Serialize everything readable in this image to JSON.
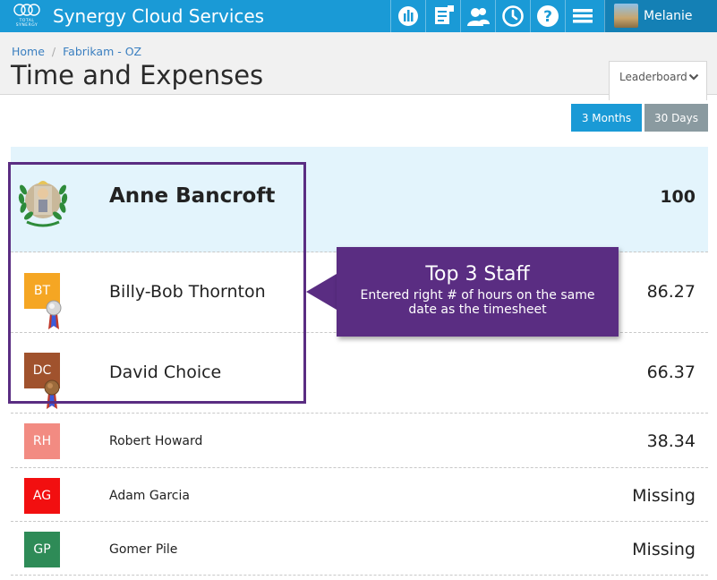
{
  "topbar": {
    "logo_tag_line1": "TOTAL",
    "logo_tag_line2": "SYNERGY",
    "app_title": "Synergy Cloud Services",
    "icons": [
      "dashboard-icon",
      "documents-icon",
      "people-icon",
      "clock-icon",
      "help-icon",
      "menu-icon"
    ],
    "user_name": "Melanie",
    "bar_color": "#1a9ad6"
  },
  "breadcrumb": {
    "items": [
      "Home",
      "Fabrikam - OZ"
    ]
  },
  "page": {
    "title": "Time and Expenses"
  },
  "dropdown": {
    "label": "Leaderboard",
    "icon": "chevron-down-icon"
  },
  "range": {
    "options": [
      "3 Months",
      "30 Days"
    ],
    "selected": "3 Months"
  },
  "leaderboard": {
    "rows": [
      {
        "initials": "",
        "name": "Anne Bancroft",
        "score": "100",
        "rank_icon": "laurel-wreath-icon"
      },
      {
        "initials": "BT",
        "name": "Billy-Bob Thornton",
        "score": "86.27",
        "badge_color": "#f5a623",
        "rank_icon": "silver-medal-icon"
      },
      {
        "initials": "DC",
        "name": "David Choice",
        "score": "66.37",
        "badge_color": "#a0522d",
        "rank_icon": "bronze-medal-icon"
      },
      {
        "initials": "RH",
        "name": "Robert Howard",
        "score": "38.34",
        "badge_color": "#f28b82"
      },
      {
        "initials": "AG",
        "name": "Adam Garcia",
        "score": "Missing",
        "badge_color": "#f20f10"
      },
      {
        "initials": "GP",
        "name": "Gomer Pile",
        "score": "Missing",
        "badge_color": "#2e8b57"
      }
    ]
  },
  "callout": {
    "title": "Top 3 Staff",
    "subtitle": "Entered right # of hours on the same date as the timesheet",
    "color": "#5a2d82"
  }
}
